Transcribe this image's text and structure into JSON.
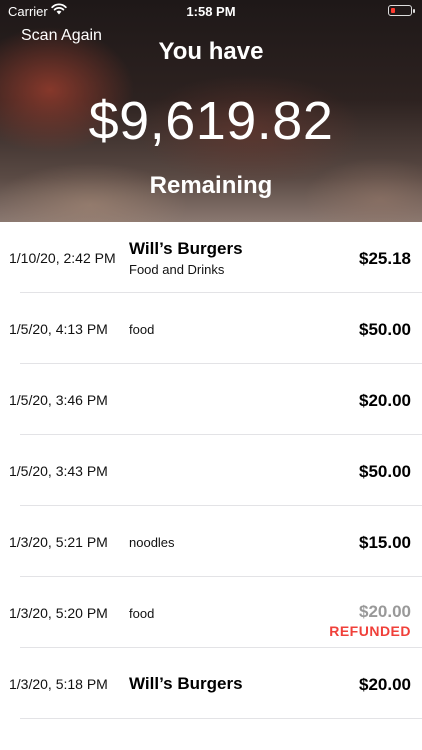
{
  "status_bar": {
    "carrier": "Carrier",
    "time": "1:58 PM",
    "battery_color": "#ff3b30"
  },
  "header": {
    "scan_again_label": "Scan Again",
    "you_have": "You have",
    "amount": "$9,619.82",
    "remaining": "Remaining"
  },
  "transactions": [
    {
      "date": "1/10/20, 2:42 PM",
      "merchant": "Will’s Burgers",
      "description": "Food and Drinks",
      "amount": "$25.18"
    },
    {
      "date": "1/5/20, 4:13 PM",
      "merchant": "",
      "description": "food",
      "amount": "$50.00"
    },
    {
      "date": "1/5/20, 3:46 PM",
      "merchant": "",
      "description": "",
      "amount": "$20.00"
    },
    {
      "date": "1/5/20, 3:43 PM",
      "merchant": "",
      "description": "",
      "amount": "$50.00"
    },
    {
      "date": "1/3/20, 5:21 PM",
      "merchant": "",
      "description": "noodles",
      "amount": "$15.00"
    },
    {
      "date": "1/3/20, 5:20 PM",
      "merchant": "",
      "description": "food",
      "amount": "$20.00",
      "status": "REFUNDED"
    },
    {
      "date": "1/3/20, 5:18 PM",
      "merchant": "Will’s Burgers",
      "description": "",
      "amount": "$20.00"
    }
  ],
  "colors": {
    "refunded_label": "#f0403a",
    "refunded_amount": "#999999",
    "separator": "#e3e3e6"
  }
}
